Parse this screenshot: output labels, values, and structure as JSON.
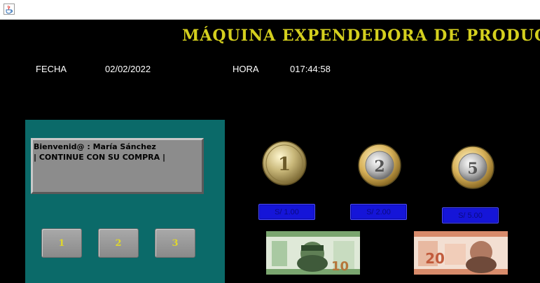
{
  "header": {
    "title": "MÁQUINA EXPENDEDORA DE PRODUCTOS"
  },
  "info": {
    "date_label": "FECHA",
    "date_value": "02/02/2022",
    "time_label": "HORA",
    "time_value": "017:44:58"
  },
  "display": {
    "line1": "Bienvenid@ : María Sánchez",
    "line2": "| CONTINUE CON  SU COMPRA |"
  },
  "keypad": {
    "keys": [
      "1",
      "2",
      "3"
    ]
  },
  "coins": [
    {
      "denomination": "1",
      "label": "S/ 1.00"
    },
    {
      "denomination": "2",
      "label": "S/ 2.00"
    },
    {
      "denomination": "5",
      "label": "S/ 5.00"
    }
  ],
  "bills": [
    {
      "denomination": "10",
      "color": "#4c9a56"
    },
    {
      "denomination": "20",
      "color": "#d9886a"
    }
  ],
  "icons": {
    "app_icon": "java-cup-icon"
  },
  "colors": {
    "title": "#d4cf1e",
    "panel": "#0b6a69",
    "coin_button": "#1515d8",
    "key_text": "#e0d72a"
  }
}
